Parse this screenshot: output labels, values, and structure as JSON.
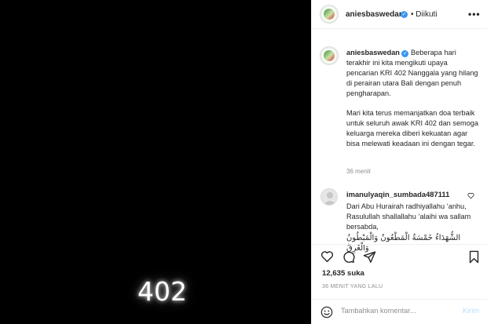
{
  "media": {
    "overlay_text": "402"
  },
  "header": {
    "username": "aniesbaswedan",
    "follow_status": "• Diikuti",
    "more_glyph": "•••"
  },
  "caption": {
    "username": "aniesbaswedan",
    "para1": "Beberapa hari terakhir ini kita mengikuti upaya pencarian KRI 402 Nanggala yang hilang di perairan utara Bali dengan penuh pengharapan.",
    "para2": "Mari kita terus memanjatkan doa terbaik untuk seluruh awak KRI 402 dan semoga keluarga mereka diberi kekuatan agar bisa melewati keadaan ini dengan tegar.",
    "time": "36 menit"
  },
  "comment": {
    "username": "imanulyaqin_sumbada487111",
    "text": "Dari Abu Hurairah radhiyallahu ‘anhu, Rasulullah shallallahu ‘alaihi wa sallam bersabda,",
    "arabic": "الشُّهَدَاءُ خَمْسَةٌ الْمَطْعُونُ وَالْمَبْطُونُ وَالْغَرِقُ"
  },
  "actions": {
    "icons": [
      "heart-icon",
      "comment-icon",
      "share-icon",
      "bookmark-icon"
    ]
  },
  "likes": "12,635 suka",
  "post_time": "36 MENIT YANG LALU",
  "comment_bar": {
    "placeholder": "Tambahkan komentar...",
    "post_label": "Kirim"
  },
  "colors": {
    "accent": "#3897f0",
    "post_disabled": "#b2dffc",
    "muted": "#8e8e8e"
  }
}
